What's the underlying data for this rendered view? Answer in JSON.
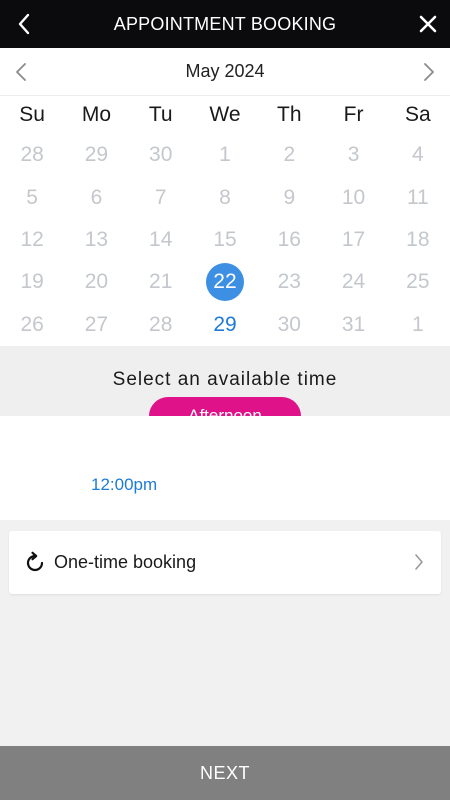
{
  "header": {
    "title": "APPOINTMENT BOOKING"
  },
  "calendar": {
    "month_label": "May 2024",
    "weekdays": [
      "Su",
      "Mo",
      "Tu",
      "We",
      "Th",
      "Fr",
      "Sa"
    ],
    "weeks": [
      [
        "28",
        "29",
        "30",
        "1",
        "2",
        "3",
        "4"
      ],
      [
        "5",
        "6",
        "7",
        "8",
        "9",
        "10",
        "11"
      ],
      [
        "12",
        "13",
        "14",
        "15",
        "16",
        "17",
        "18"
      ],
      [
        "19",
        "20",
        "21",
        "22",
        "23",
        "24",
        "25"
      ],
      [
        "26",
        "27",
        "28",
        "29",
        "30",
        "31",
        "1"
      ]
    ],
    "selected_day": "22",
    "available_days": [
      "29"
    ]
  },
  "time_selection": {
    "label": "Select an available time",
    "period": "Afternoon",
    "slots": [
      "12:00pm"
    ]
  },
  "booking_type": {
    "label": "One-time booking"
  },
  "footer": {
    "next_label": "NEXT"
  },
  "colors": {
    "accent_blue": "#3d8fe4",
    "link_blue": "#1e7bd8",
    "pill_magenta": "#e0128a",
    "header_bg": "#0b0b0d",
    "footer_bg": "#808080"
  },
  "icons": {
    "back": "chevron-left-icon",
    "close": "close-icon",
    "prev_month": "chevron-left-icon",
    "next_month": "chevron-right-icon",
    "booking": "refresh-icon",
    "booking_chevron": "chevron-right-icon"
  }
}
